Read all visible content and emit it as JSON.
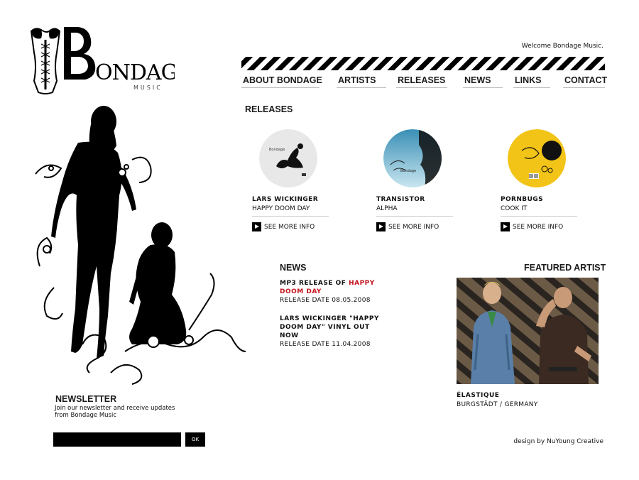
{
  "header": {
    "welcome": "Welcome Bondage Music."
  },
  "nav": {
    "items": [
      {
        "label": "ABOUT BONDAGE"
      },
      {
        "label": "ARTISTS"
      },
      {
        "label": "RELEASES"
      },
      {
        "label": "NEWS"
      },
      {
        "label": "LINKS"
      },
      {
        "label": "CONTACT"
      }
    ]
  },
  "releases": {
    "heading": "RELEASES",
    "more_label": "SEE MORE INFO",
    "items": [
      {
        "artist": "LARS WICKINGER",
        "title": "HAPPY DOOM DAY",
        "disc_color": "#e8e8e8"
      },
      {
        "artist": "TRANSISTOR",
        "title": "ALPHA",
        "disc_color": "#6fb6d2"
      },
      {
        "artist": "PORNBUGS",
        "title": "COOK IT",
        "disc_color": "#f2c417"
      }
    ]
  },
  "news": {
    "heading": "NEWS",
    "items": [
      {
        "title_prefix": "MP3 RELEASE OF ",
        "title_highlight": "HAPPY DOOM DAY",
        "date": "RELEASE DATE 08.05.2008"
      },
      {
        "title_prefix": "LARS WICKINGER \"HAPPY DOOM DAY\" VINYL OUT NOW",
        "title_highlight": "",
        "date": "RELEASE DATE 11.04.2008"
      }
    ]
  },
  "featured": {
    "heading": "FEATURED ARTIST",
    "name": "ÉLASTIQUE",
    "location": "BURGSTÄDT / GERMANY"
  },
  "newsletter": {
    "heading": "NEWSLETTER",
    "text": "Join our newsletter and receive updates from Bondage Music",
    "input_value": "",
    "button_label": "OK"
  },
  "footer": {
    "credit": "design by NuYoung Creative"
  },
  "colors": {
    "accent_red": "#c4121d",
    "black": "#000000"
  }
}
